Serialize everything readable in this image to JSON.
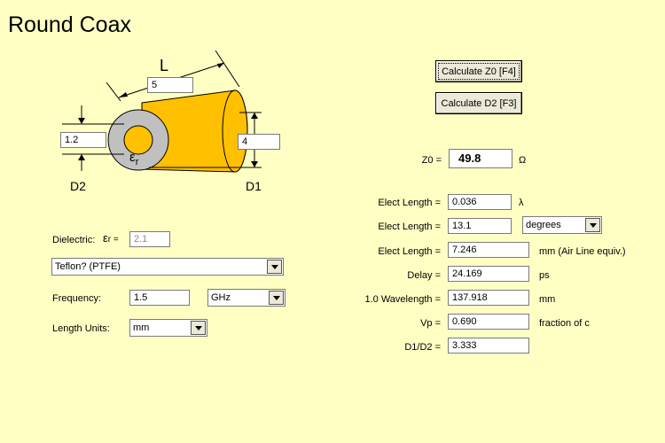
{
  "title": "Round Coax",
  "diagram": {
    "length_label": "L",
    "length_value": "5",
    "inner_value": "1.2",
    "outer_value": "4",
    "d2_label": "D2",
    "d1_label": "D1",
    "er_symbol": "ε",
    "er_sub": "r",
    "colors": {
      "conductor": "#ffc000",
      "dielectric": "#c0c0c0"
    }
  },
  "buttons": {
    "calc_z0": "Calculate Z0  [F4]",
    "calc_d2": "Calculate D2  [F3]"
  },
  "z0": {
    "label": "Z0 =",
    "value": "49.8",
    "unit": "Ω"
  },
  "dielectric": {
    "label": "Dielectric:",
    "er_symbol": "ε",
    "er_sub": "r =",
    "er_value": "2.1",
    "material": "Teflon?  (PTFE)"
  },
  "frequency": {
    "label": "Frequency:",
    "value": "1.5",
    "unit": "GHz"
  },
  "length_units": {
    "label": "Length Units:",
    "value": "mm"
  },
  "results": [
    {
      "label": "Elect Length =",
      "value": "0.036",
      "unit": "λ"
    },
    {
      "label": "Elect Length =",
      "value": "13.1",
      "unit": "degrees"
    },
    {
      "label": "Elect Length =",
      "value": "7.246",
      "unit": "mm  (Air Line equiv.)"
    },
    {
      "label": "Delay =",
      "value": "24.169",
      "unit": "ps"
    },
    {
      "label": "1.0 Wavelength =",
      "value": "137.918",
      "unit": "mm"
    },
    {
      "label": "Vp =",
      "value": "0.690",
      "unit": "fraction of c"
    },
    {
      "label": "D1/D2 =",
      "value": "3.333",
      "unit": ""
    }
  ]
}
